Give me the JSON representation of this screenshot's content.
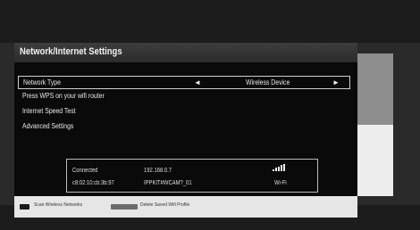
{
  "dialog": {
    "title": "Network/Internet Settings"
  },
  "rows": [
    {
      "label": "Network Type",
      "value": "Wireless Device",
      "selected": true
    },
    {
      "label": "Press WPS on your wifi router"
    },
    {
      "label": "Internet Speed Test"
    },
    {
      "label": "Advanced Settings"
    }
  ],
  "status": {
    "state": "Connected",
    "ip": "192.168.0.7",
    "mac": "c8:02:10:cb:3b:97",
    "ssid": "IPPKIT#WCAM?_01",
    "connection_type": "Wi-Fi"
  },
  "footer": {
    "scan_label": "Scan Wireless Networks",
    "scan_key_color": "#1a1a1a",
    "delete_label": "Delete Saved Wifi Profile",
    "delete_key_color": "#6b6b6b"
  },
  "icons": {
    "arrow_left": "◄",
    "arrow_right": "►",
    "signal": "signal-bars-icon"
  }
}
